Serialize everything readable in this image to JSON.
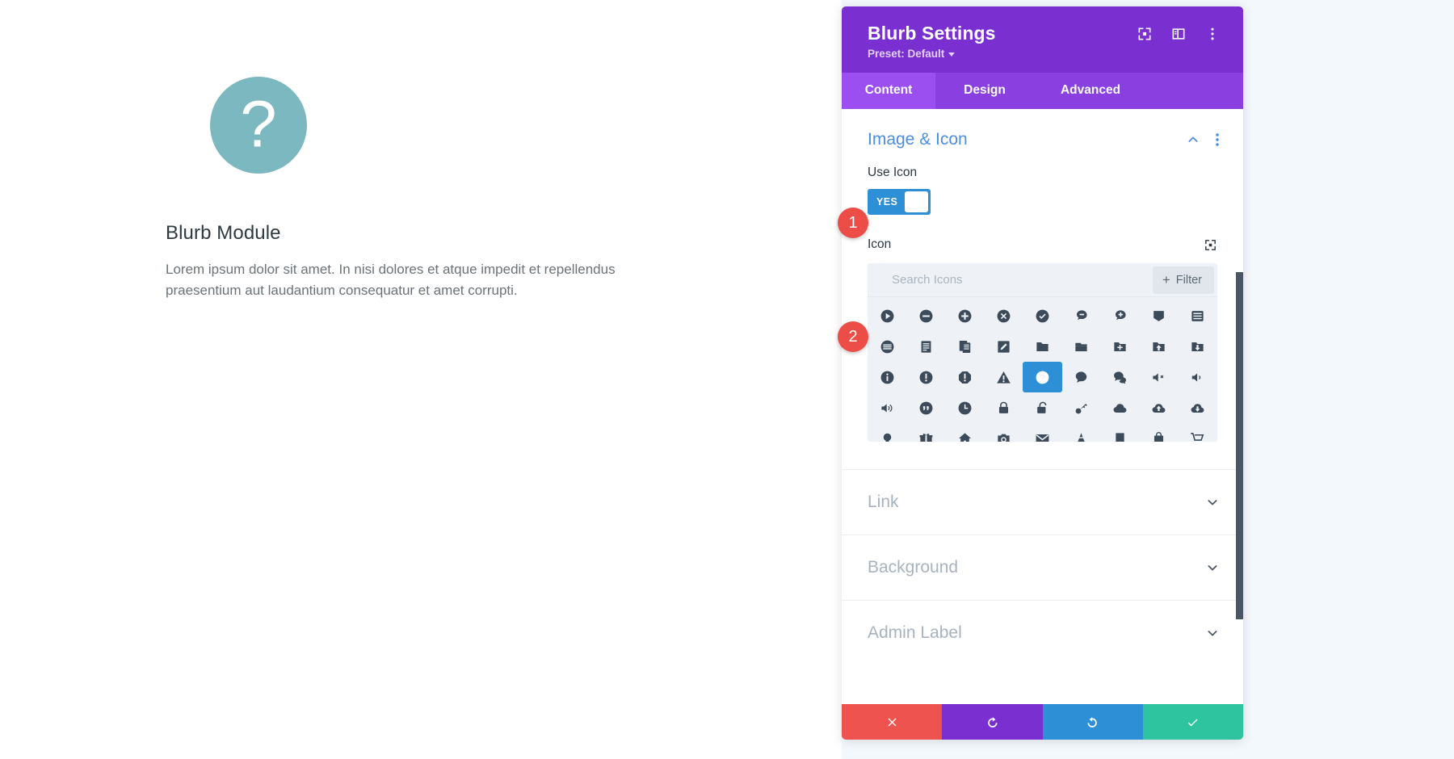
{
  "preview": {
    "icon_name": "question-circle-icon",
    "icon_color": "#7cb8bf",
    "title": "Blurb Module",
    "description": "Lorem ipsum dolor sit amet. In nisi dolores et atque impedit et repellendus praesentium aut laudantium consequatur et amet corrupti."
  },
  "panel": {
    "title": "Blurb Settings",
    "preset_label": "Preset: Default",
    "header_icons": [
      {
        "name": "fullscreen-icon"
      },
      {
        "name": "layout-panel-icon"
      },
      {
        "name": "kebab-menu-icon"
      }
    ],
    "tabs": [
      {
        "label": "Content",
        "active": true
      },
      {
        "label": "Design",
        "active": false
      },
      {
        "label": "Advanced",
        "active": false
      }
    ],
    "section": {
      "title": "Image & Icon",
      "collapse_icon": "chevron-up-icon",
      "options_icon": "kebab-menu-icon"
    },
    "use_icon": {
      "label": "Use Icon",
      "toggle_value": "YES",
      "enabled": true
    },
    "icon_field": {
      "label": "Icon",
      "reset_icon": "fullscreen-icon"
    },
    "icon_picker": {
      "search_placeholder": "Search Icons",
      "search_value": "",
      "filter_label": "Filter",
      "selected_icon": "question-circle-icon",
      "selected_index": 22,
      "columns": 9,
      "icons": [
        "play-circle-icon",
        "minus-circle-icon",
        "plus-circle-icon",
        "times-circle-icon",
        "check-circle-icon",
        "comment-minus-icon",
        "comment-plus-icon",
        "tag-icon",
        "list-box-icon",
        "menu-circle-icon",
        "document-lines-icon",
        "documents-copy-icon",
        "pencil-box-icon",
        "folder-icon",
        "folder-open-icon",
        "folder-plus-icon",
        "folder-upload-icon",
        "folder-download-icon",
        "info-circle-icon",
        "exclamation-circle-icon",
        "exclamation-octagon-icon",
        "warning-triangle-icon",
        "question-circle-icon",
        "comment-icon",
        "comments-icon",
        "volume-mute-icon",
        "volume-low-icon",
        "volume-high-icon",
        "quote-circle-icon",
        "clock-icon",
        "lock-closed-icon",
        "lock-open-icon",
        "key-icon",
        "cloud-icon",
        "cloud-upload-icon",
        "cloud-download-icon",
        "lightbulb-icon",
        "gift-icon",
        "home-icon",
        "camera-icon",
        "envelope-icon",
        "traffic-cone-icon",
        "bookmark-icon",
        "shopping-bag-icon",
        "shopping-cart-icon"
      ]
    },
    "collapsed_sections": [
      {
        "label": "Link",
        "chevron": "chevron-down-icon"
      },
      {
        "label": "Background",
        "chevron": "chevron-down-icon"
      },
      {
        "label": "Admin Label",
        "chevron": "chevron-down-icon"
      }
    ],
    "footer_buttons": [
      {
        "name": "cancel-button",
        "icon": "times-icon",
        "color": "#ef5350"
      },
      {
        "name": "undo-button",
        "icon": "undo-icon",
        "color": "#7a2fd0"
      },
      {
        "name": "redo-button",
        "icon": "redo-icon",
        "color": "#2d8fd5"
      },
      {
        "name": "save-button",
        "icon": "check-icon",
        "color": "#2ec4a0"
      }
    ]
  },
  "annotations": [
    {
      "number": "1",
      "target": "use-icon-toggle"
    },
    {
      "number": "2",
      "target": "icon-picker"
    }
  ]
}
